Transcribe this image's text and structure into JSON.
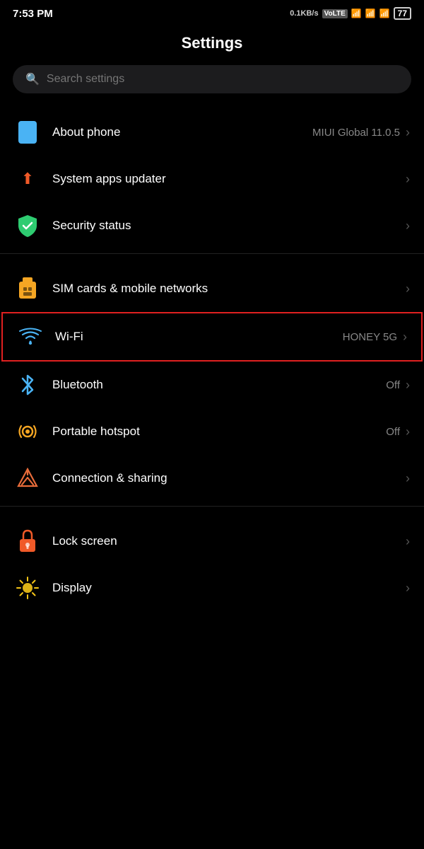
{
  "statusBar": {
    "time": "7:53 PM",
    "speed": "0.1KB/s",
    "carrier1": "VoLTE",
    "battery": "77"
  },
  "page": {
    "title": "Settings"
  },
  "search": {
    "placeholder": "Search settings"
  },
  "items": [
    {
      "id": "about-phone",
      "label": "About phone",
      "value": "MIUI Global 11.0.5",
      "icon": "phone",
      "interactable": true
    },
    {
      "id": "system-apps-updater",
      "label": "System apps updater",
      "value": "",
      "icon": "arrow-up",
      "interactable": true
    },
    {
      "id": "security-status",
      "label": "Security status",
      "value": "",
      "icon": "shield",
      "interactable": true
    },
    {
      "id": "sim-cards",
      "label": "SIM cards & mobile networks",
      "value": "",
      "icon": "sim",
      "interactable": true
    },
    {
      "id": "wifi",
      "label": "Wi-Fi",
      "value": "HONEY 5G",
      "icon": "wifi",
      "interactable": true,
      "highlighted": true
    },
    {
      "id": "bluetooth",
      "label": "Bluetooth",
      "value": "Off",
      "icon": "bluetooth",
      "interactable": true
    },
    {
      "id": "portable-hotspot",
      "label": "Portable hotspot",
      "value": "Off",
      "icon": "hotspot",
      "interactable": true
    },
    {
      "id": "connection-sharing",
      "label": "Connection & sharing",
      "value": "",
      "icon": "connection",
      "interactable": true
    },
    {
      "id": "lock-screen",
      "label": "Lock screen",
      "value": "",
      "icon": "lock",
      "interactable": true
    },
    {
      "id": "display",
      "label": "Display",
      "value": "",
      "icon": "display",
      "interactable": true
    }
  ],
  "dividers": [
    2,
    3,
    7,
    8
  ],
  "labels": {
    "chevron": "›"
  }
}
